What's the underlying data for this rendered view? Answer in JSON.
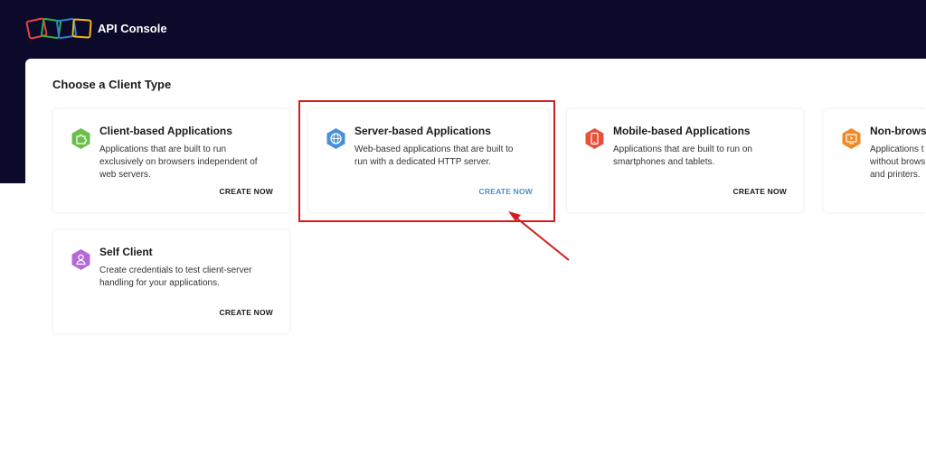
{
  "app": {
    "title": "API Console",
    "logo_colors": [
      "#e8423f",
      "#2bb24c",
      "#2d7fd1",
      "#f2b519"
    ]
  },
  "page": {
    "heading": "Choose a Client Type"
  },
  "client_types": [
    {
      "title": "Client-based Applications",
      "description": "Applications that are built to run exclusively on browsers independent of web servers.",
      "cta": "CREATE NOW",
      "icon": "puzzle-icon",
      "color": "#6abf4b"
    },
    {
      "title": "Server-based Applications",
      "description": "Web-based applications that are built to run with a dedicated HTTP server.",
      "cta": "CREATE NOW",
      "icon": "globe-icon",
      "color": "#4a90d9",
      "highlighted": true
    },
    {
      "title": "Mobile-based Applications",
      "description": "Applications that are built to run on smartphones and tablets.",
      "cta": "CREATE NOW",
      "icon": "mobile-phone-icon",
      "color": "#e8503a"
    },
    {
      "title": "Non-browse",
      "description": "Applications t without brows and printers.",
      "cta": "",
      "icon": "tv-screen-icon",
      "color": "#f08a24"
    },
    {
      "title": "Self Client",
      "description": "Create credentials to test client-server handling for your applications.",
      "cta": "CREATE NOW",
      "icon": "user-icon",
      "color": "#b469d6"
    }
  ],
  "annotation": {
    "highlight_color": "#d51c1c",
    "arrow_color": "#d51c1c"
  }
}
